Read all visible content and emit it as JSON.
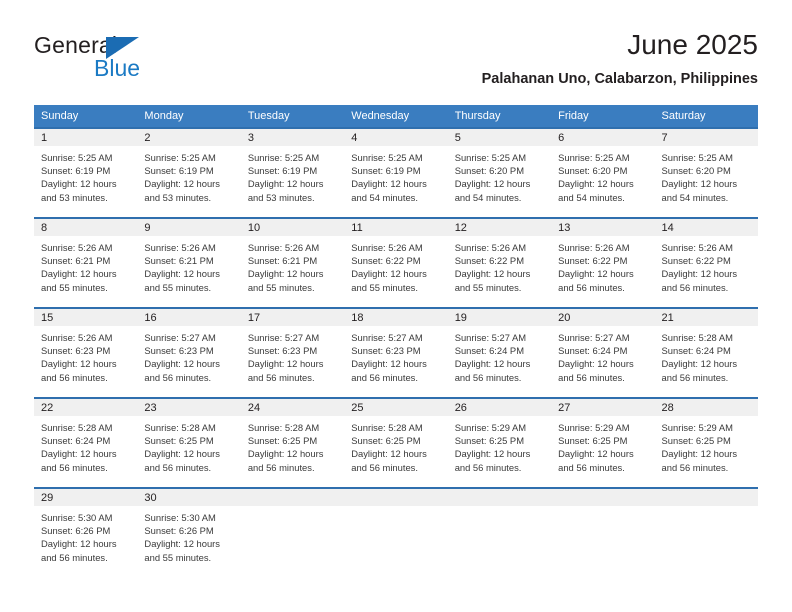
{
  "brand": {
    "name_top": "General",
    "name_bottom": "Blue",
    "accent_color": "#1b7ac4",
    "triangle_color": "#1b6cb3"
  },
  "header": {
    "title": "June 2025",
    "subtitle": "Palahanan Uno, Calabarzon, Philippines"
  },
  "calendar": {
    "header_bg": "#3a7dc0",
    "row_divider_color": "#2f6fae",
    "daynum_band_bg": "#f0f0f0",
    "weekday_headers": [
      "Sunday",
      "Monday",
      "Tuesday",
      "Wednesday",
      "Thursday",
      "Friday",
      "Saturday"
    ],
    "weeks": [
      [
        {
          "day": "1",
          "sunrise": "Sunrise: 5:25 AM",
          "sunset": "Sunset: 6:19 PM",
          "daylight": "Daylight: 12 hours and 53 minutes."
        },
        {
          "day": "2",
          "sunrise": "Sunrise: 5:25 AM",
          "sunset": "Sunset: 6:19 PM",
          "daylight": "Daylight: 12 hours and 53 minutes."
        },
        {
          "day": "3",
          "sunrise": "Sunrise: 5:25 AM",
          "sunset": "Sunset: 6:19 PM",
          "daylight": "Daylight: 12 hours and 53 minutes."
        },
        {
          "day": "4",
          "sunrise": "Sunrise: 5:25 AM",
          "sunset": "Sunset: 6:19 PM",
          "daylight": "Daylight: 12 hours and 54 minutes."
        },
        {
          "day": "5",
          "sunrise": "Sunrise: 5:25 AM",
          "sunset": "Sunset: 6:20 PM",
          "daylight": "Daylight: 12 hours and 54 minutes."
        },
        {
          "day": "6",
          "sunrise": "Sunrise: 5:25 AM",
          "sunset": "Sunset: 6:20 PM",
          "daylight": "Daylight: 12 hours and 54 minutes."
        },
        {
          "day": "7",
          "sunrise": "Sunrise: 5:25 AM",
          "sunset": "Sunset: 6:20 PM",
          "daylight": "Daylight: 12 hours and 54 minutes."
        }
      ],
      [
        {
          "day": "8",
          "sunrise": "Sunrise: 5:26 AM",
          "sunset": "Sunset: 6:21 PM",
          "daylight": "Daylight: 12 hours and 55 minutes."
        },
        {
          "day": "9",
          "sunrise": "Sunrise: 5:26 AM",
          "sunset": "Sunset: 6:21 PM",
          "daylight": "Daylight: 12 hours and 55 minutes."
        },
        {
          "day": "10",
          "sunrise": "Sunrise: 5:26 AM",
          "sunset": "Sunset: 6:21 PM",
          "daylight": "Daylight: 12 hours and 55 minutes."
        },
        {
          "day": "11",
          "sunrise": "Sunrise: 5:26 AM",
          "sunset": "Sunset: 6:22 PM",
          "daylight": "Daylight: 12 hours and 55 minutes."
        },
        {
          "day": "12",
          "sunrise": "Sunrise: 5:26 AM",
          "sunset": "Sunset: 6:22 PM",
          "daylight": "Daylight: 12 hours and 55 minutes."
        },
        {
          "day": "13",
          "sunrise": "Sunrise: 5:26 AM",
          "sunset": "Sunset: 6:22 PM",
          "daylight": "Daylight: 12 hours and 56 minutes."
        },
        {
          "day": "14",
          "sunrise": "Sunrise: 5:26 AM",
          "sunset": "Sunset: 6:22 PM",
          "daylight": "Daylight: 12 hours and 56 minutes."
        }
      ],
      [
        {
          "day": "15",
          "sunrise": "Sunrise: 5:26 AM",
          "sunset": "Sunset: 6:23 PM",
          "daylight": "Daylight: 12 hours and 56 minutes."
        },
        {
          "day": "16",
          "sunrise": "Sunrise: 5:27 AM",
          "sunset": "Sunset: 6:23 PM",
          "daylight": "Daylight: 12 hours and 56 minutes."
        },
        {
          "day": "17",
          "sunrise": "Sunrise: 5:27 AM",
          "sunset": "Sunset: 6:23 PM",
          "daylight": "Daylight: 12 hours and 56 minutes."
        },
        {
          "day": "18",
          "sunrise": "Sunrise: 5:27 AM",
          "sunset": "Sunset: 6:23 PM",
          "daylight": "Daylight: 12 hours and 56 minutes."
        },
        {
          "day": "19",
          "sunrise": "Sunrise: 5:27 AM",
          "sunset": "Sunset: 6:24 PM",
          "daylight": "Daylight: 12 hours and 56 minutes."
        },
        {
          "day": "20",
          "sunrise": "Sunrise: 5:27 AM",
          "sunset": "Sunset: 6:24 PM",
          "daylight": "Daylight: 12 hours and 56 minutes."
        },
        {
          "day": "21",
          "sunrise": "Sunrise: 5:28 AM",
          "sunset": "Sunset: 6:24 PM",
          "daylight": "Daylight: 12 hours and 56 minutes."
        }
      ],
      [
        {
          "day": "22",
          "sunrise": "Sunrise: 5:28 AM",
          "sunset": "Sunset: 6:24 PM",
          "daylight": "Daylight: 12 hours and 56 minutes."
        },
        {
          "day": "23",
          "sunrise": "Sunrise: 5:28 AM",
          "sunset": "Sunset: 6:25 PM",
          "daylight": "Daylight: 12 hours and 56 minutes."
        },
        {
          "day": "24",
          "sunrise": "Sunrise: 5:28 AM",
          "sunset": "Sunset: 6:25 PM",
          "daylight": "Daylight: 12 hours and 56 minutes."
        },
        {
          "day": "25",
          "sunrise": "Sunrise: 5:28 AM",
          "sunset": "Sunset: 6:25 PM",
          "daylight": "Daylight: 12 hours and 56 minutes."
        },
        {
          "day": "26",
          "sunrise": "Sunrise: 5:29 AM",
          "sunset": "Sunset: 6:25 PM",
          "daylight": "Daylight: 12 hours and 56 minutes."
        },
        {
          "day": "27",
          "sunrise": "Sunrise: 5:29 AM",
          "sunset": "Sunset: 6:25 PM",
          "daylight": "Daylight: 12 hours and 56 minutes."
        },
        {
          "day": "28",
          "sunrise": "Sunrise: 5:29 AM",
          "sunset": "Sunset: 6:25 PM",
          "daylight": "Daylight: 12 hours and 56 minutes."
        }
      ],
      [
        {
          "day": "29",
          "sunrise": "Sunrise: 5:30 AM",
          "sunset": "Sunset: 6:26 PM",
          "daylight": "Daylight: 12 hours and 56 minutes."
        },
        {
          "day": "30",
          "sunrise": "Sunrise: 5:30 AM",
          "sunset": "Sunset: 6:26 PM",
          "daylight": "Daylight: 12 hours and 55 minutes."
        },
        {
          "day": "",
          "sunrise": "",
          "sunset": "",
          "daylight": ""
        },
        {
          "day": "",
          "sunrise": "",
          "sunset": "",
          "daylight": ""
        },
        {
          "day": "",
          "sunrise": "",
          "sunset": "",
          "daylight": ""
        },
        {
          "day": "",
          "sunrise": "",
          "sunset": "",
          "daylight": ""
        },
        {
          "day": "",
          "sunrise": "",
          "sunset": "",
          "daylight": ""
        }
      ]
    ]
  }
}
